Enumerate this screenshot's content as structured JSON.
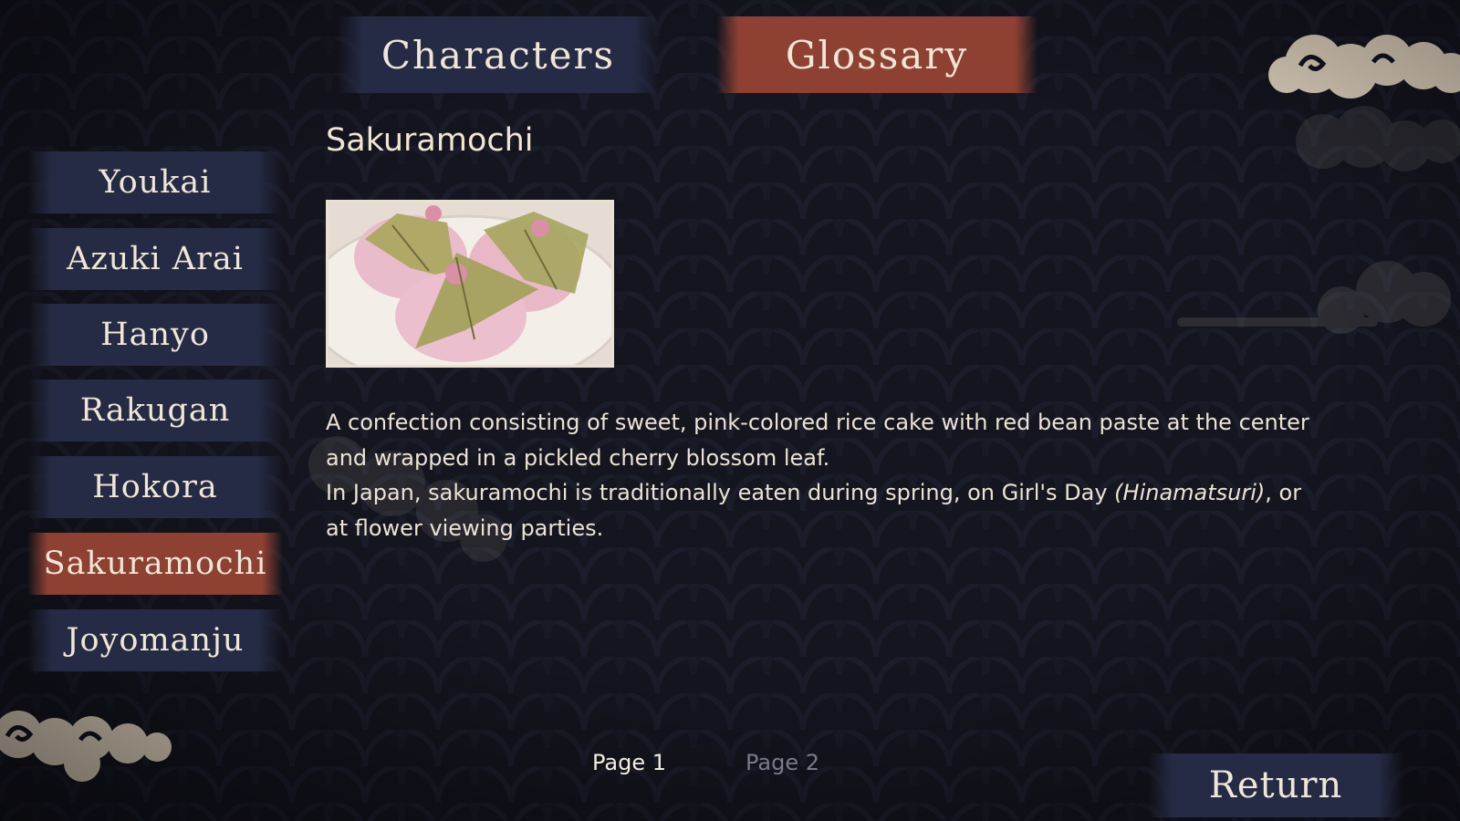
{
  "tabs": {
    "characters": "Characters",
    "glossary": "Glossary",
    "active": "Glossary"
  },
  "sidebar": {
    "items": [
      {
        "label": "Youkai",
        "selected": false
      },
      {
        "label": "Azuki Arai",
        "selected": false
      },
      {
        "label": "Hanyo",
        "selected": false
      },
      {
        "label": "Rakugan",
        "selected": false
      },
      {
        "label": "Hokora",
        "selected": false
      },
      {
        "label": "Sakuramochi",
        "selected": true
      },
      {
        "label": "Joyomanju",
        "selected": false
      }
    ]
  },
  "entry": {
    "title": "Sakuramochi",
    "image_icon": "sakuramochi-illustration",
    "description": {
      "line1": "A confection consisting of sweet, pink-colored rice cake with red bean paste at the center and wrapped in a pickled cherry blossom leaf.",
      "line2_prefix": "In Japan, sakuramochi is traditionally eaten during spring, on Girl's Day ",
      "line2_italic": "(Hinamatsuri)",
      "line2_suffix": ", or at flower viewing parties."
    }
  },
  "pagination": {
    "page1": "Page 1",
    "page2": "Page 2",
    "current": 1
  },
  "return_label": "Return",
  "colors": {
    "background": "#13141f",
    "tab_inactive": "#262b45",
    "tab_active": "#8e4033",
    "text": "#efe6d6",
    "cloud": "#e7d8c4"
  }
}
